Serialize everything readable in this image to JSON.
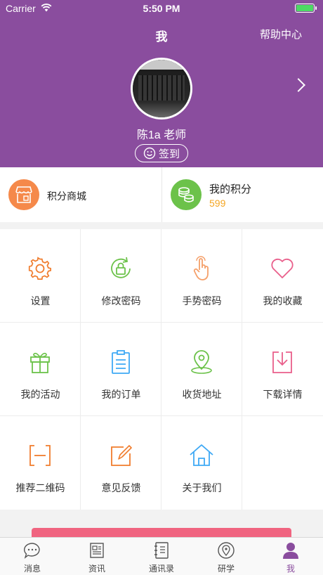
{
  "status_bar": {
    "carrier": "Carrier",
    "time": "5:50 PM"
  },
  "nav": {
    "title": "我",
    "help": "帮助中心"
  },
  "profile": {
    "name": "陈1a 老师",
    "checkin_label": "签到"
  },
  "points": {
    "mall_label": "积分商城",
    "my_points_label": "我的积分",
    "my_points_value": "599"
  },
  "grid": {
    "items": [
      {
        "label": "设置",
        "icon": "gear-icon",
        "color": "#f07c2d"
      },
      {
        "label": "修改密码",
        "icon": "lock-refresh-icon",
        "color": "#6cc24a"
      },
      {
        "label": "手势密码",
        "icon": "hand-tap-icon",
        "color": "#f5a06a"
      },
      {
        "label": "我的收藏",
        "icon": "heart-icon",
        "color": "#e95f8b"
      },
      {
        "label": "我的活动",
        "icon": "gift-icon",
        "color": "#6cc24a"
      },
      {
        "label": "我的订单",
        "icon": "clipboard-icon",
        "color": "#3fa9f5"
      },
      {
        "label": "收货地址",
        "icon": "location-pin-icon",
        "color": "#6cc24a"
      },
      {
        "label": "下载详情",
        "icon": "download-icon",
        "color": "#e95f8b"
      },
      {
        "label": "推荐二维码",
        "icon": "qr-scan-icon",
        "color": "#f07c2d"
      },
      {
        "label": "意见反馈",
        "icon": "edit-icon",
        "color": "#f07c2d"
      },
      {
        "label": "关于我们",
        "icon": "home-icon",
        "color": "#3fa9f5"
      }
    ]
  },
  "tabs": [
    {
      "label": "消息",
      "icon": "chat-icon"
    },
    {
      "label": "资讯",
      "icon": "news-icon"
    },
    {
      "label": "通讯录",
      "icon": "contacts-icon"
    },
    {
      "label": "研学",
      "icon": "map-pin-icon"
    },
    {
      "label": "我",
      "icon": "user-icon",
      "active": true
    }
  ],
  "colors": {
    "brand": "#8a4d9e",
    "mall_icon_bg": "#f5894a",
    "points_icon_bg": "#6cc24a",
    "points_value": "#f5a623",
    "logout": "#f06480"
  }
}
